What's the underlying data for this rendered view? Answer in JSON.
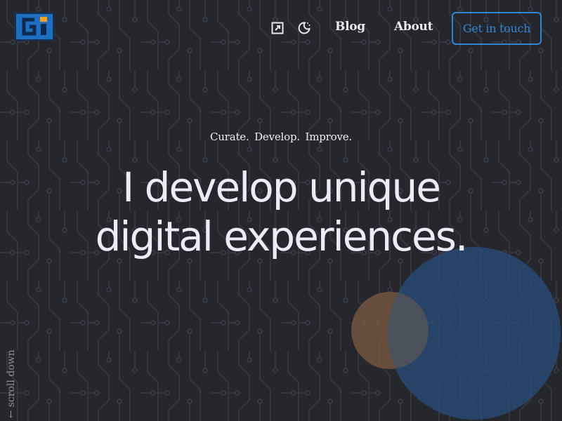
{
  "header": {
    "logo_text": "Gi",
    "nav": {
      "blog": "Blog",
      "about": "About"
    },
    "cta_label": "Get in touch",
    "icons": [
      "expand-icon",
      "theme-toggle-icon"
    ]
  },
  "hero": {
    "tagline": "Curate.  Develop.  Improve.",
    "headline_line1": "I develop unique",
    "headline_line2": "digital experiences."
  },
  "scroll_hint": {
    "arrow": "←",
    "label": "scroll down"
  },
  "colors": {
    "background": "#25272d",
    "accent": "#2f86d6",
    "text": "#eeeaf8",
    "logo_blue": "#1f6fc0",
    "logo_orange": "#f0a21c",
    "orb_blue": "#294c78",
    "orb_orange": "#785840"
  }
}
